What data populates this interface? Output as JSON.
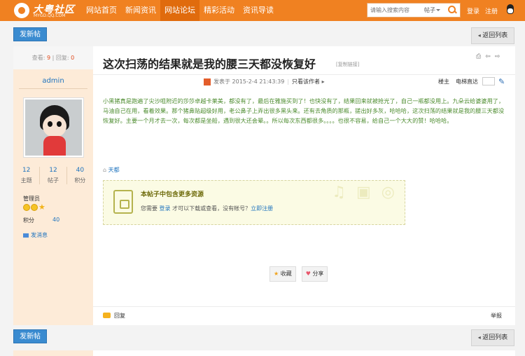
{
  "header": {
    "logo_text": "大粤社区",
    "logo_sub": "MYGD.QQ.COM",
    "nav": [
      "网站首页",
      "新闻资讯",
      "网站论坛",
      "精彩活动",
      "资讯导读"
    ],
    "search_placeholder": "请输入搜索内容",
    "search_scope": "帖子",
    "login": "登录",
    "register": "注册",
    "accent_color": "#f08121"
  },
  "toolbar": {
    "post_button": "发新帖",
    "back_button": "返回列表"
  },
  "post_stats": {
    "views_label": "查看:",
    "views": "9",
    "sep": "|",
    "replies_label": "回复:",
    "replies": "0"
  },
  "author": {
    "name": "admin",
    "counts": [
      {
        "value": "12",
        "label": "主题"
      },
      {
        "value": "12",
        "label": "帖子"
      },
      {
        "value": "40",
        "label": "积分"
      }
    ],
    "role": "管理员",
    "points_label": "积分",
    "points": "40",
    "message_link": "发消息"
  },
  "post": {
    "title": "这次扫荡的结果就是我的腰三天都没恢复好",
    "title_tag": "[复制链接]",
    "posted": "发表于 2015-2-4 21:43:39",
    "sep": "|",
    "only_author": "只看该作者",
    "floor": "楼主",
    "jump": "电梯直达",
    "content": "小黑猪真是跑遍了尖沙咀附近的莎莎卓越卡莱美，都没有了，最后在雅施买到了！也快没有了，结果回来就被抢光了，自己一瓶都没用上。九朵云给婆婆用了，马油自己在用，看着效果。那个猪鼻贴超级好用，老公鼻子上弄出很多黑头来。还有去角质的那瓶，搓出好多灰，哈哈哈，这次扫荡的结果就是我的腰三天都没恢复好。主要一个月才去一次，每次都是坐船，遇到很大还会晕。。所以每次东西都很多。。。。也很不容易，给自己一个大大的赞！哈哈哈。",
    "tag": "天都",
    "attachment": {
      "heading": "本帖子中包含更多资源",
      "prefix": "您需要",
      "login": "登录",
      "middle": "才可以下载或查看，没有帐号？",
      "register": "立即注册"
    },
    "favorite": "收藏",
    "share": "分享",
    "reply": "回复",
    "report": "举报"
  }
}
